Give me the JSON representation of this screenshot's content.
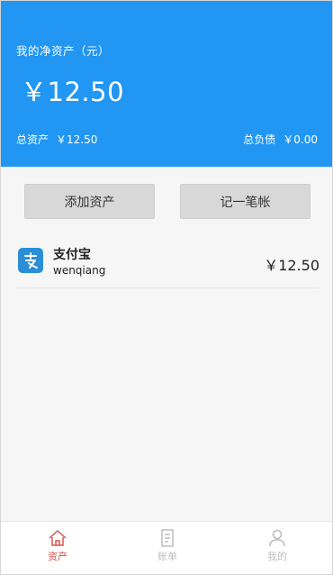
{
  "header": {
    "net_assets_label": "我的净资产（元）",
    "net_assets_value": "￥12.50",
    "total_assets_label": "总资产",
    "total_assets_value": "￥12.50",
    "total_debts_label": "总负债",
    "total_debts_value": "￥0.00",
    "color": "#2196f3"
  },
  "actions": {
    "add_asset_label": "添加资产",
    "record_label": "记一笔帐"
  },
  "accounts": [
    {
      "icon": "alipay-icon",
      "name": "支付宝",
      "user": "wenqiang",
      "amount": "￥12.50"
    }
  ],
  "tabbar": {
    "items": [
      {
        "label": "资产",
        "icon": "home-icon",
        "active": true,
        "color": "#d9534f"
      },
      {
        "label": "账单",
        "icon": "bill-icon",
        "active": false
      },
      {
        "label": "我的",
        "icon": "person-icon",
        "active": false
      }
    ]
  }
}
